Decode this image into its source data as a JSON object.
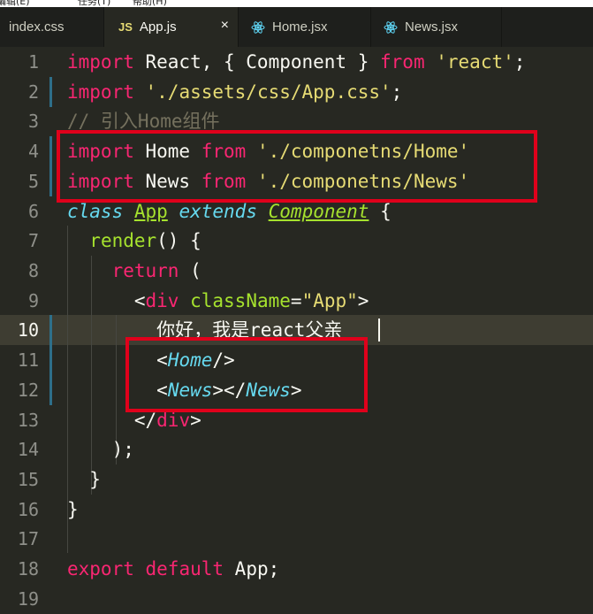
{
  "menubar": {
    "items": [
      "编辑(E)",
      "任务(T)",
      "帮助(H)"
    ]
  },
  "tabs": [
    {
      "label": "index.css",
      "icon": "none",
      "active": false
    },
    {
      "label": "App.js",
      "icon": "js-icon",
      "js_badge": "JS",
      "active": true,
      "close": "×"
    },
    {
      "label": "Home.jsx",
      "icon": "react-icon",
      "active": false
    },
    {
      "label": "News.jsx",
      "icon": "react-icon",
      "active": false
    }
  ],
  "code": {
    "line_numbers": [
      "1",
      "2",
      "3",
      "4",
      "5",
      "6",
      "7",
      "8",
      "9",
      "10",
      "11",
      "12",
      "13",
      "14",
      "15",
      "16",
      "17",
      "18",
      "19"
    ],
    "current_line": 10,
    "modified_lines": [
      2,
      4,
      5,
      10,
      11,
      12
    ],
    "line1": {
      "kw1": "import",
      "mid": " React, { Component } ",
      "kw2": "from",
      "str": "'react'",
      "end": ";"
    },
    "line2": {
      "kw": "import",
      "str": "'./assets/css/App.css'",
      "end": ";"
    },
    "line3": {
      "comment": "// 引入Home组件"
    },
    "line4": {
      "kw1": "import",
      "name": " Home ",
      "kw2": "from",
      "str": "'./componetns/Home'"
    },
    "line5": {
      "kw1": "import",
      "name": " News ",
      "kw2": "from",
      "str": "'./componetns/News'"
    },
    "line6": {
      "storage": "class",
      "cls": "App",
      "ext": "extends",
      "base": "Component",
      "brace": " {"
    },
    "line7": {
      "fn": "render",
      "rest": "() {"
    },
    "line8": {
      "kw": "return",
      "rest": " ("
    },
    "line9": {
      "open": "<",
      "tag": "div",
      "attr": "className",
      "eq": "=",
      "str": "\"App\"",
      "close": ">"
    },
    "line10": {
      "text": "你好，我是react父亲"
    },
    "line11": {
      "open": "<",
      "comp": "Home",
      "close": "/>"
    },
    "line12": {
      "open": "<",
      "comp1": "News",
      "mid": "></",
      "comp2": "News",
      "close": ">"
    },
    "line13": {
      "open": "</",
      "tag": "div",
      "close": ">"
    },
    "line14": {
      "text": ");"
    },
    "line15": {
      "text": "}"
    },
    "line16": {
      "text": "}"
    },
    "line17": {
      "text": ""
    },
    "line18": {
      "kw1": "export",
      "kw2": "default",
      "rest": " App;"
    },
    "line19": {
      "text": ""
    }
  },
  "colors": {
    "background": "#272822",
    "keyword": "#f92672",
    "string": "#e6db74",
    "comment": "#75715e",
    "class_name": "#a6e22e",
    "component": "#66d9ef",
    "highlight_box": "#e0001b"
  }
}
